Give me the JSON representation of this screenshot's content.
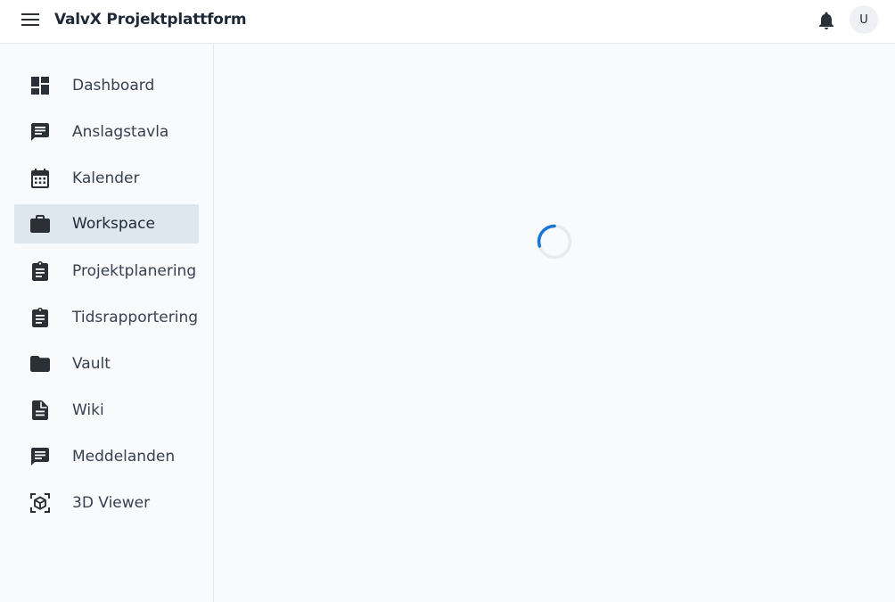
{
  "header": {
    "title": "ValvX Projektplattform",
    "avatar_initial": "U"
  },
  "sidebar": {
    "items": [
      {
        "label": "Dashboard",
        "icon": "dashboard-icon",
        "active": false
      },
      {
        "label": "Anslagstavla",
        "icon": "message-icon",
        "active": false
      },
      {
        "label": "Kalender",
        "icon": "calendar-icon",
        "active": false
      },
      {
        "label": "Workspace",
        "icon": "briefcase-icon",
        "active": true
      },
      {
        "label": "Projektplanering",
        "icon": "clipboard-icon",
        "active": false
      },
      {
        "label": "Tidsrapportering",
        "icon": "clipboard-icon",
        "active": false
      },
      {
        "label": "Vault",
        "icon": "folder-icon",
        "active": false
      },
      {
        "label": "Wiki",
        "icon": "document-icon",
        "active": false
      },
      {
        "label": "Meddelanden",
        "icon": "message-icon",
        "active": false
      },
      {
        "label": "3D Viewer",
        "icon": "cube-icon",
        "active": false
      }
    ]
  },
  "main": {
    "loading_icon": "spinner-icon"
  },
  "colors": {
    "active_item_bg": "#dde7ed",
    "spinner": "#1976d2",
    "icon": "#2b2f36"
  }
}
